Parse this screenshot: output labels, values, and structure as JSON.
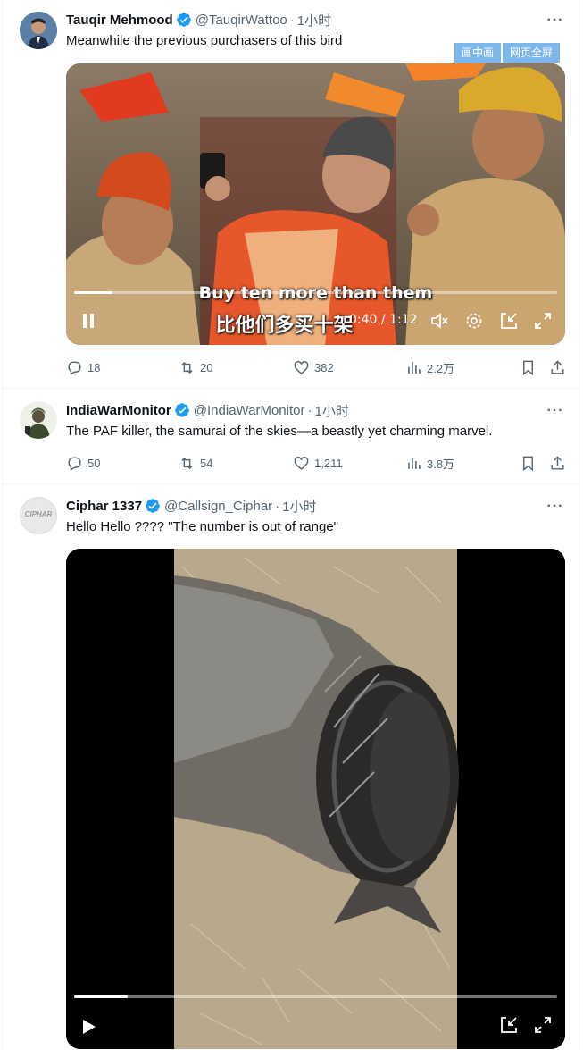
{
  "tweets": [
    {
      "name": "Tauqir Mehmood",
      "handle": "@TauqirWattoo",
      "time": "1小时",
      "text": "Meanwhile the previous purchasers of this bird",
      "media": {
        "kind": "video",
        "subtitle_en": "Buy ten more than them",
        "subtitle_zh": "比他们多买十架",
        "timecode": "0:40 / 1:12",
        "progress": 0.08,
        "state": "playing"
      },
      "stats": {
        "replies": "18",
        "retweets": "20",
        "likes": "382",
        "views": "2.2万"
      }
    },
    {
      "name": "IndiaWarMonitor",
      "handle": "@IndiaWarMonitor",
      "time": "1小时",
      "text": "The PAF killer, the samurai of the skies—a beastly yet charming marvel.",
      "stats": {
        "replies": "50",
        "retweets": "54",
        "likes": "1,211",
        "views": "3.8万"
      }
    },
    {
      "name": "Ciphar 1337",
      "handle": "@Callsign_Ciphar",
      "time": "1小时",
      "text": "Hello Hello ????  \"The number is out of range\"",
      "avatar_text": "CIPHAR",
      "media": {
        "kind": "video",
        "progress": 0.11,
        "state": "paused"
      }
    }
  ],
  "pip_buttons": {
    "pip": "画中画",
    "fullweb": "网页全屏"
  },
  "more_label": "···",
  "colors": {
    "verified": "#1d9bf0",
    "muted": "#536471",
    "border": "#eff3f4"
  }
}
